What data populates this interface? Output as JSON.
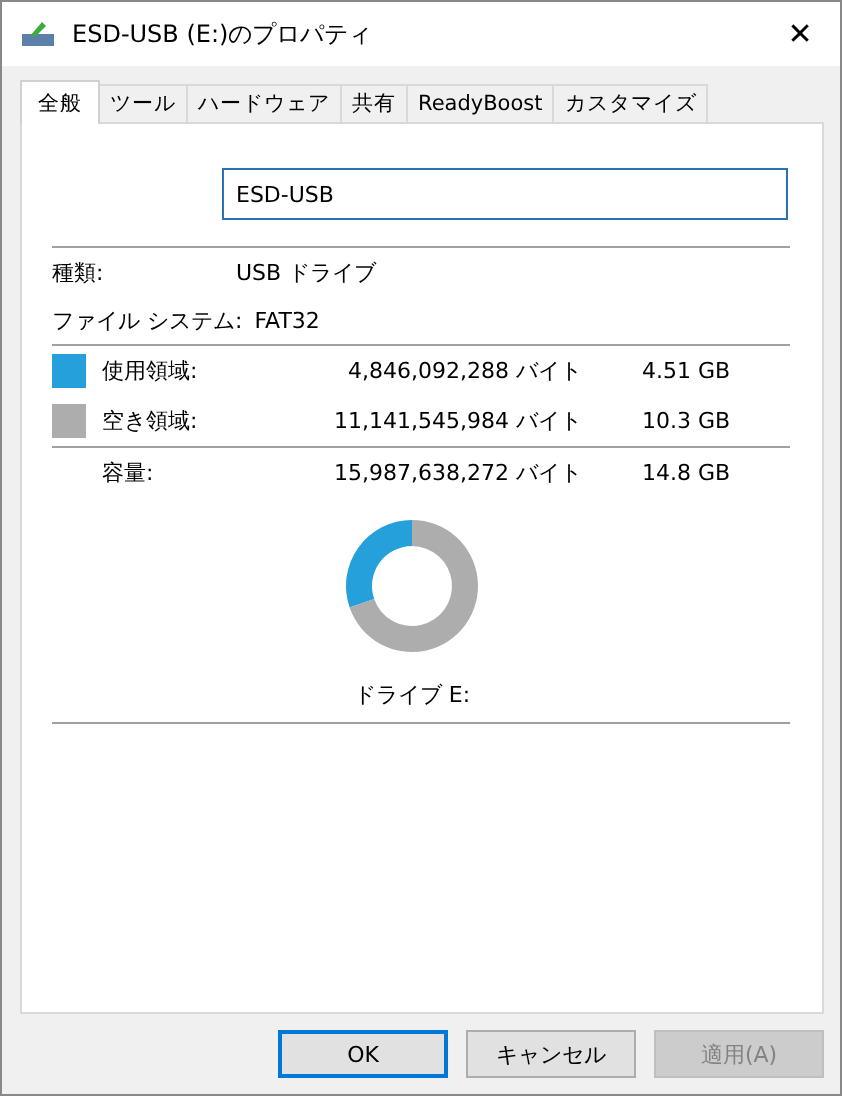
{
  "window": {
    "title": "ESD-USB (E:)のプロパティ",
    "close": "✕"
  },
  "tabs": [
    {
      "label": "全般",
      "selected": true
    },
    {
      "label": "ツール",
      "selected": false
    },
    {
      "label": "ハードウェア",
      "selected": false
    },
    {
      "label": "共有",
      "selected": false
    },
    {
      "label": "ReadyBoost",
      "selected": false
    },
    {
      "label": "カスタマイズ",
      "selected": false
    }
  ],
  "name_field": {
    "value": "ESD-USB"
  },
  "info": [
    {
      "label": "種類:",
      "value": "USB ドライブ"
    },
    {
      "label": "ファイル システム:",
      "value": "FAT32"
    }
  ],
  "usage": [
    {
      "label": "使用領域:",
      "bytes": "4,846,092,288 バイト",
      "size": "4.51 GB",
      "color": "#26a0da"
    },
    {
      "label": "空き領域:",
      "bytes": "11,141,545,984 バイト",
      "size": "10.3 GB",
      "color": "#adadad"
    }
  ],
  "capacity": {
    "label": "容量:",
    "bytes": "15,987,638,272 バイト",
    "size": "14.8 GB"
  },
  "chart_data": {
    "type": "donut",
    "values": [
      30.3,
      69.7
    ]
  },
  "drive_label": "ドライブ E:",
  "buttons": [
    {
      "label": "OK",
      "default": true,
      "disabled": false
    },
    {
      "label": "キャンセル",
      "default": false,
      "disabled": false
    },
    {
      "label": "適用(A)",
      "default": false,
      "disabled": true
    }
  ]
}
